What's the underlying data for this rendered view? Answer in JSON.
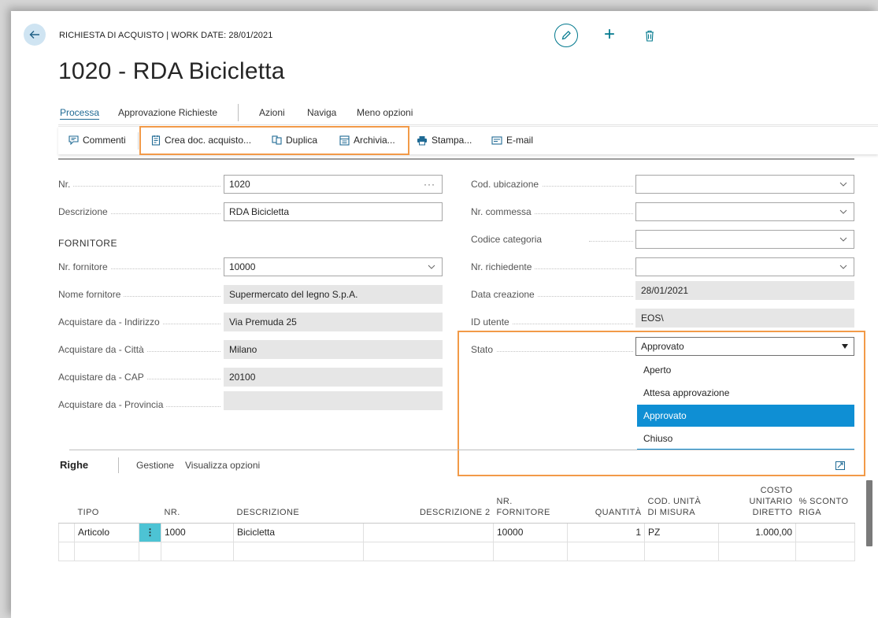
{
  "header": {
    "caption": "RICHIESTA DI ACQUISTO | WORK DATE: 28/01/2021",
    "title": "1020 - RDA Bicicletta"
  },
  "actions": {
    "items": [
      "Processa",
      "Approvazione Richieste",
      "Azioni",
      "Naviga",
      "Meno opzioni"
    ]
  },
  "toolbar": {
    "commenti": "Commenti",
    "crea": "Crea doc. acquisto...",
    "duplica": "Duplica",
    "archivia": "Archivia...",
    "stampa": "Stampa...",
    "email": "E-mail"
  },
  "form": {
    "left": {
      "nr_label": "Nr.",
      "nr_value": "1020",
      "descr_label": "Descrizione",
      "descr_value": "RDA Bicicletta",
      "section": "FORNITORE",
      "fornitore_label": "Nr. fornitore",
      "fornitore_value": "10000",
      "nome_label": "Nome fornitore",
      "nome_value": "Supermercato del legno S.p.A.",
      "indirizzo_label": "Acquistare da - Indirizzo",
      "indirizzo_value": "Via Premuda 25",
      "citta_label": "Acquistare da - Città",
      "citta_value": "Milano",
      "cap_label": "Acquistare da - CAP",
      "cap_value": "20100",
      "provincia_label": "Acquistare da - Provincia",
      "provincia_value": ""
    },
    "right": {
      "ubicazione_label": "Cod. ubicazione",
      "ubicazione_value": "",
      "commessa_label": "Nr. commessa",
      "commessa_value": "",
      "categoria_label": "Codice categoria",
      "categoria_value": "",
      "richiedente_label": "Nr. richiedente",
      "richiedente_value": "",
      "data_label": "Data creazione",
      "data_value": "28/01/2021",
      "utente_label": "ID utente",
      "utente_value": "EOS\\",
      "stato_label": "Stato",
      "stato_value": "Approvato",
      "stato_options": [
        "Aperto",
        "Attesa approvazione",
        "Approvato",
        "Chiuso"
      ]
    }
  },
  "lines": {
    "tabs": [
      "Righe",
      "Gestione",
      "Visualizza opzioni"
    ],
    "columns": {
      "tipo": "TIPO",
      "nr": "NR.",
      "descrizione": "DESCRIZIONE",
      "descrizione2": "DESCRIZIONE 2",
      "nr_fornitore_1": "NR.",
      "nr_fornitore_2": "FORNITORE",
      "quantita": "QUANTITÀ",
      "um_1": "COD. UNITÀ",
      "um_2": "DI MISURA",
      "costo_1": "COSTO",
      "costo_2": "UNITARIO",
      "costo_3": "DIRETTO",
      "sconto_1": "% SCONTO",
      "sconto_2": "RIGA"
    },
    "rows": [
      {
        "tipo": "Articolo",
        "nr": "1000",
        "descrizione": "Bicicletta",
        "descrizione2": "",
        "nr_fornitore": "10000",
        "quantita": "1",
        "um": "PZ",
        "costo": "1.000,00",
        "sconto": ""
      }
    ]
  },
  "colors": {
    "accent": "#00788d",
    "link": "#1f6a94",
    "highlight": "#f29a48",
    "selected": "#0f8fd4"
  }
}
